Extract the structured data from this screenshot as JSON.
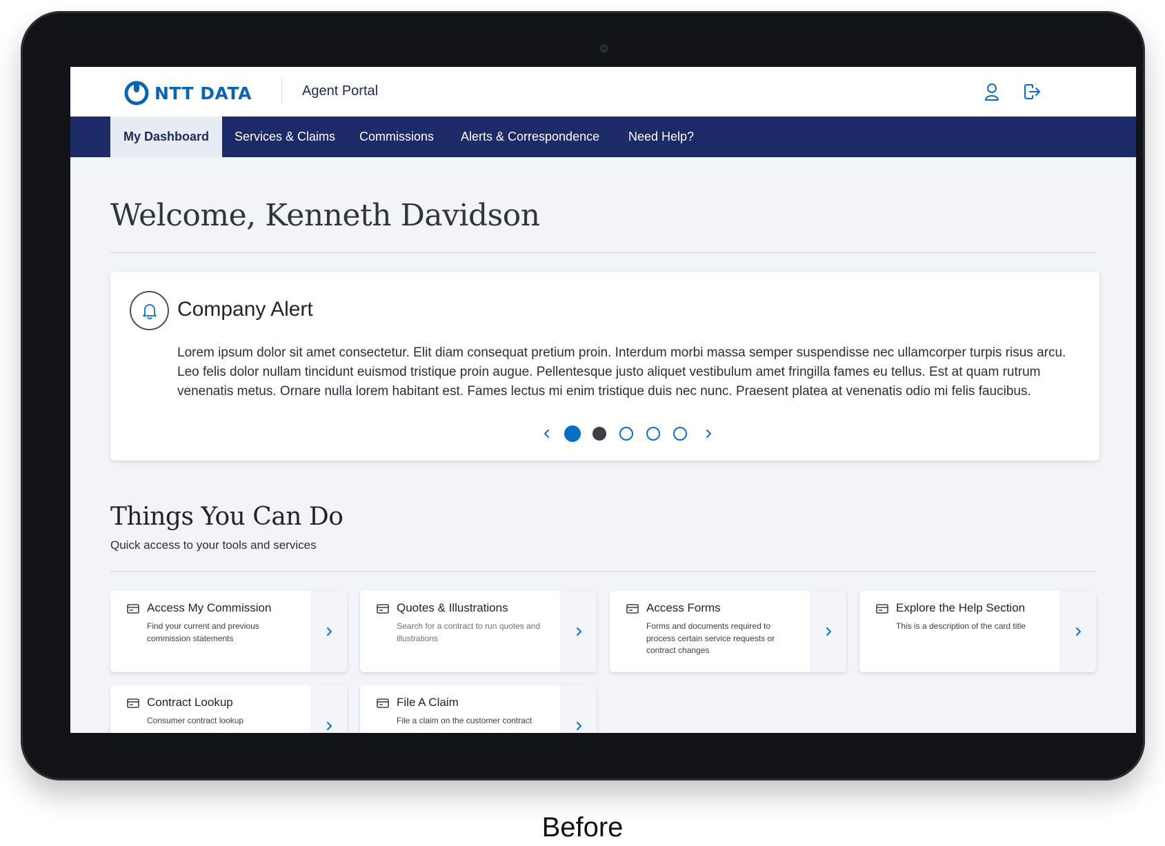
{
  "brand": {
    "logo_text": "NTT DATA",
    "portal_name": "Agent Portal",
    "primary_color": "#1c2a67",
    "accent_color": "#0a6fc4"
  },
  "header_icons": [
    "user-icon",
    "logout-icon"
  ],
  "nav": {
    "items": [
      {
        "label": "My Dashboard",
        "active": true
      },
      {
        "label": "Services & Claims",
        "active": false
      },
      {
        "label": "Commissions",
        "active": false
      },
      {
        "label": "Alerts & Correspondence",
        "active": false
      },
      {
        "label": "Need Help?",
        "active": false
      }
    ]
  },
  "welcome": "Welcome, Kenneth Davidson",
  "alert": {
    "title": "Company Alert",
    "icon": "bell-icon",
    "body": "Lorem ipsum dolor sit amet consectetur. Elit diam consequat pretium proin. Interdum morbi massa semper suspendisse nec ullamcorper turpis risus arcu. Leo felis dolor nullam tincidunt euismod tristique proin augue. Pellentesque justo aliquet vestibulum amet fringilla fames eu tellus. Est at quam rutrum venenatis metus. Ornare nulla lorem habitant est. Fames lectus mi enim tristique duis nec nunc. Praesent platea at venenatis odio mi felis faucibus.",
    "slides": 5,
    "current_slide": 1
  },
  "things": {
    "title": "Things You Can Do",
    "subtitle": "Quick access to your tools and services",
    "cards": [
      {
        "title": "Access My Commission",
        "desc": "Find your current and previous commission statements"
      },
      {
        "title": "Quotes & Illustrations",
        "desc": "Search for a contract to run quotes and illustrations"
      },
      {
        "title": "Access Forms",
        "desc": "Forms and documents required to process certain service requests or contract changes"
      },
      {
        "title": "Explore the Help Section",
        "desc": "This is a description of the card title"
      },
      {
        "title": "Contract Lookup",
        "desc": "Consumer contract lookup"
      },
      {
        "title": "File A Claim",
        "desc": "File a claim on the customer contract"
      }
    ]
  },
  "caption": "Before"
}
